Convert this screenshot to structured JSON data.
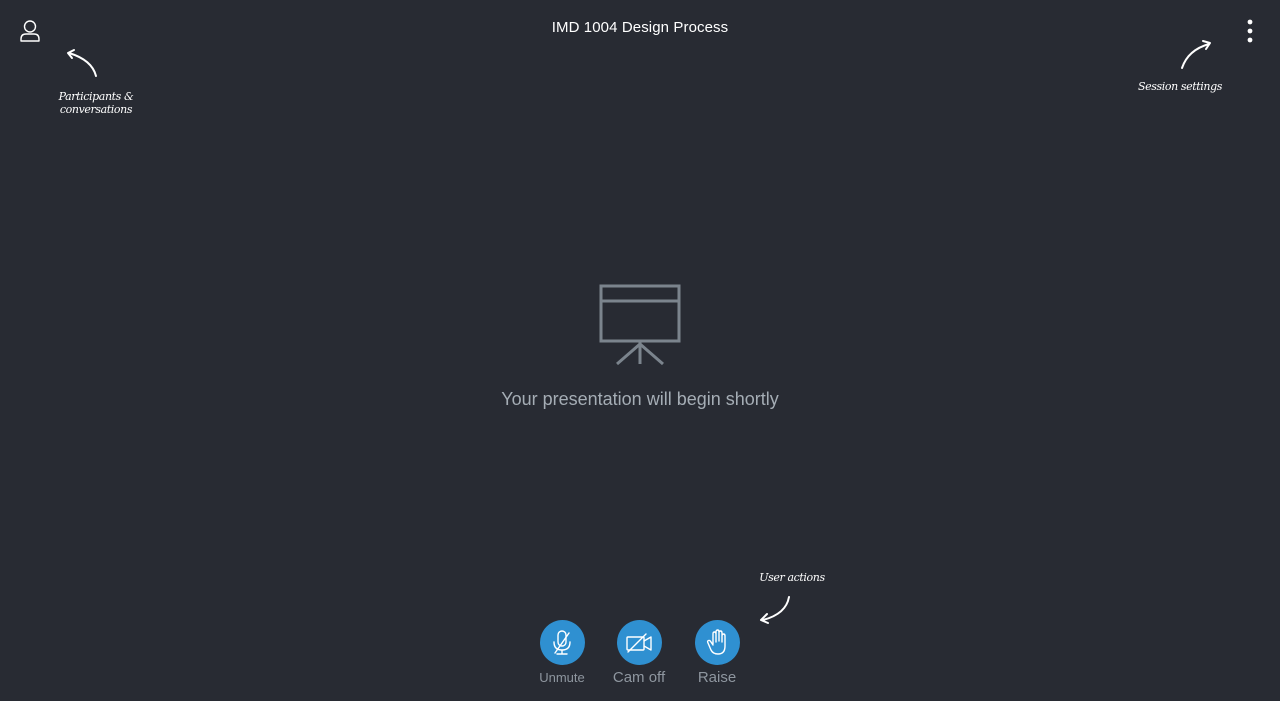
{
  "header": {
    "title": "IMD 1004 Design Process",
    "participants_icon": "user-icon",
    "settings_icon": "vertical-ellipsis-icon"
  },
  "hints": {
    "participants": "Participants & conversations",
    "settings": "Session settings",
    "actions": "User actions"
  },
  "stage": {
    "icon": "presentation-screen-icon",
    "message": "Your presentation will begin shortly"
  },
  "actions": [
    {
      "label": "Unmute",
      "icon": "microphone-muted-icon"
    },
    {
      "label": "Cam off",
      "icon": "camera-off-icon"
    },
    {
      "label": "Raise",
      "icon": "raise-hand-icon"
    }
  ],
  "colors": {
    "background": "#282b33",
    "action_button": "#2f90d1",
    "muted_text": "#a5adb5"
  }
}
